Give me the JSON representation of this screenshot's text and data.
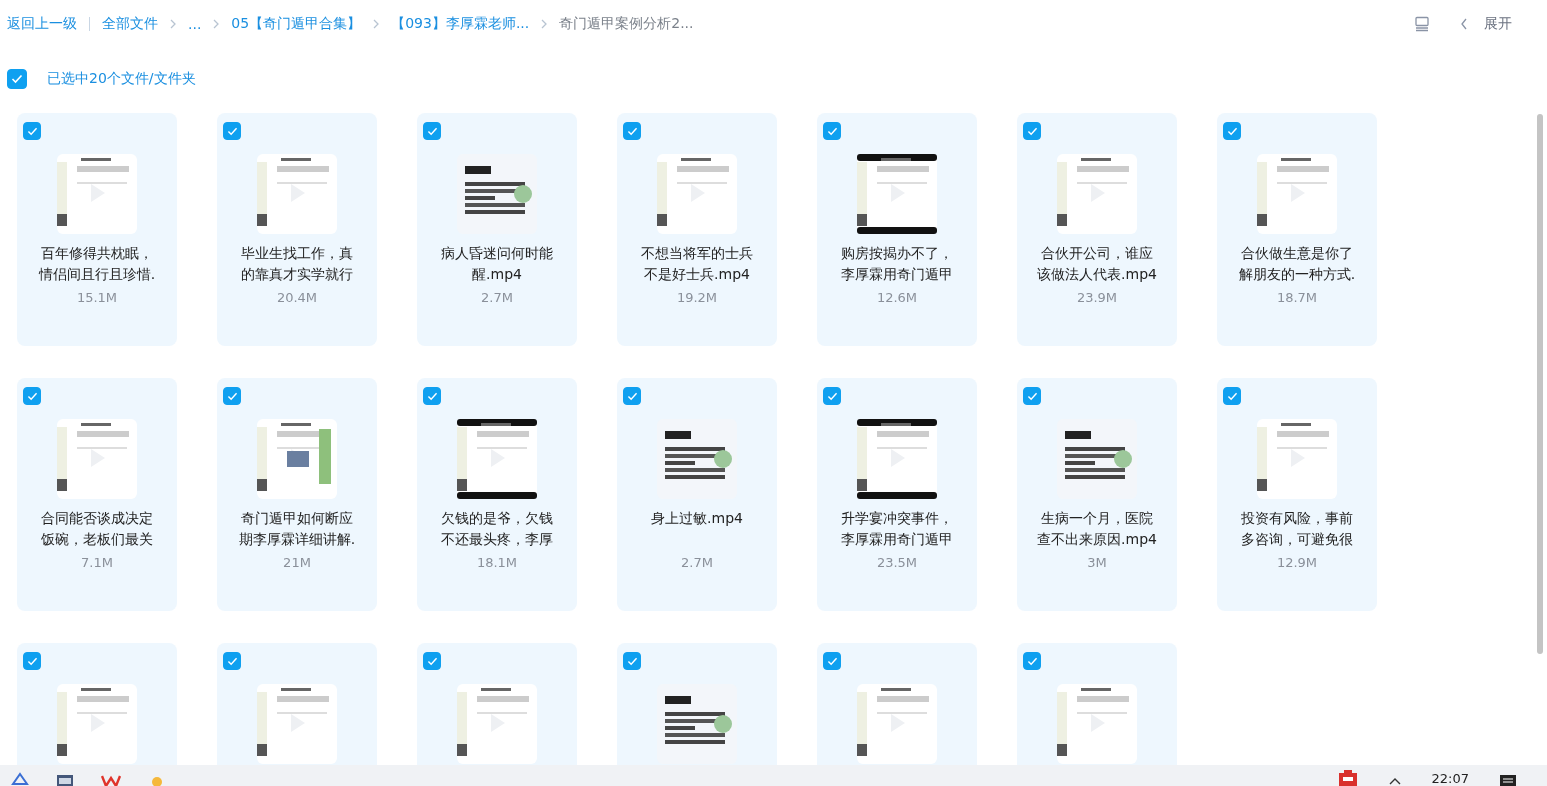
{
  "breadcrumb": {
    "back": "返回上一级",
    "items": [
      {
        "label": "全部文件",
        "current": false
      },
      {
        "label": "...",
        "current": false
      },
      {
        "label": "05【奇门遁甲合集】",
        "current": false
      },
      {
        "label": "【093】李厚霖老师...",
        "current": false
      },
      {
        "label": "奇门遁甲案例分析2...",
        "current": true
      }
    ]
  },
  "toolbar": {
    "expand": "展开"
  },
  "selection": {
    "checked": true,
    "label": "已选中20个文件/文件夹"
  },
  "files": [
    {
      "name": "百年修得共枕眠，情侣间且行且珍惜.",
      "size": "15.1M",
      "selected": true
    },
    {
      "name": "毕业生找工作，真的靠真才实学就行",
      "size": "20.4M",
      "selected": true
    },
    {
      "name": "病人昏迷问何时能醒.mp4",
      "size": "2.7M",
      "selected": true
    },
    {
      "name": "不想当将军的士兵不是好士兵.mp4",
      "size": "19.2M",
      "selected": true
    },
    {
      "name": "购房按揭办不了，李厚霖用奇门遁甲",
      "size": "12.6M",
      "selected": true
    },
    {
      "name": "合伙开公司，谁应该做法人代表.mp4",
      "size": "23.9M",
      "selected": true
    },
    {
      "name": "合伙做生意是你了解朋友的一种方式.",
      "size": "18.7M",
      "selected": true
    },
    {
      "name": "合同能否谈成决定饭碗，老板们最关",
      "size": "7.1M",
      "selected": true
    },
    {
      "name": "奇门遁甲如何断应期李厚霖详细讲解.",
      "size": "21M",
      "selected": true
    },
    {
      "name": "欠钱的是爷，欠钱不还最头疼，李厚",
      "size": "18.1M",
      "selected": true
    },
    {
      "name": "身上过敏.mp4",
      "size": "2.7M",
      "selected": true
    },
    {
      "name": "升学宴冲突事件，李厚霖用奇门遁甲",
      "size": "23.5M",
      "selected": true
    },
    {
      "name": "生病一个月，医院查不出来原因.mp4",
      "size": "3M",
      "selected": true
    },
    {
      "name": "投资有风险，事前多咨询，可避免很",
      "size": "12.9M",
      "selected": true
    },
    {
      "selected": true
    },
    {
      "selected": true
    },
    {
      "selected": true
    },
    {
      "selected": true
    },
    {
      "selected": true
    },
    {
      "selected": true
    }
  ],
  "taskbar": {
    "time": "22:07"
  }
}
